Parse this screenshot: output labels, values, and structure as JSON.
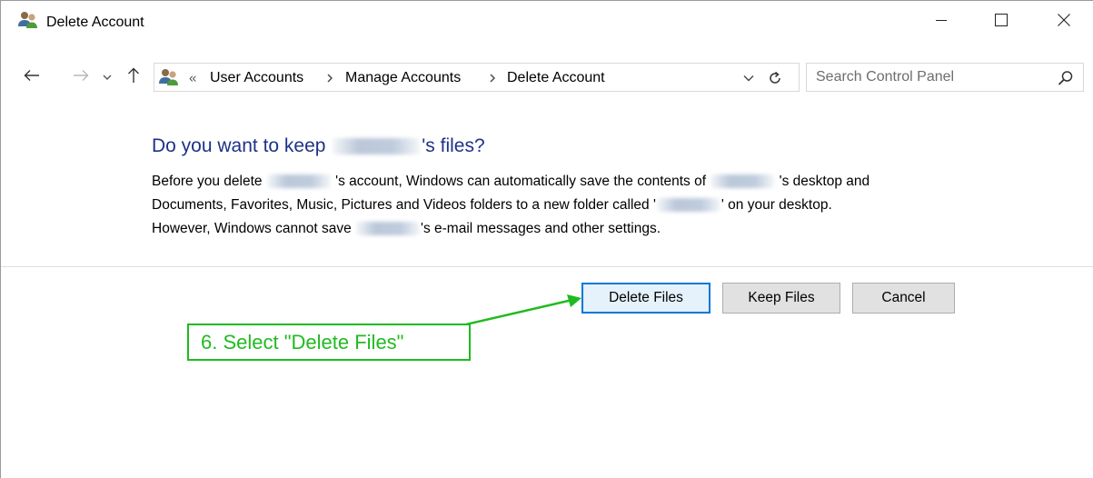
{
  "window": {
    "title": "Delete Account",
    "controls": {
      "minimize": "minimize",
      "maximize": "maximize",
      "close": "close"
    }
  },
  "navigation": {
    "breadcrumb_overflow": "«",
    "breadcrumbs": [
      "User Accounts",
      "Manage Accounts",
      "Delete Account"
    ],
    "search_placeholder": "Search Control Panel"
  },
  "content": {
    "heading_before": "Do you want to keep",
    "heading_after": "'s files?",
    "paragraph": {
      "line1_a": "Before you delete",
      "line1_b": "'s account, Windows can automatically save the contents of",
      "line1_c": "'s desktop and",
      "line2_a": "Documents, Favorites, Music, Pictures and Videos folders to a new folder called '",
      "line2_b": "' on your desktop.",
      "line3_a": "However, Windows cannot save",
      "line3_b": "'s e-mail messages and other settings."
    }
  },
  "buttons": {
    "delete_files": "Delete Files",
    "keep_files": "Keep Files",
    "cancel": "Cancel"
  },
  "annotation": {
    "text": "6. Select \"Delete Files\"",
    "color": "#1fbb1f"
  },
  "colors": {
    "heading": "#1e3287",
    "focus_border": "#0078d7"
  }
}
